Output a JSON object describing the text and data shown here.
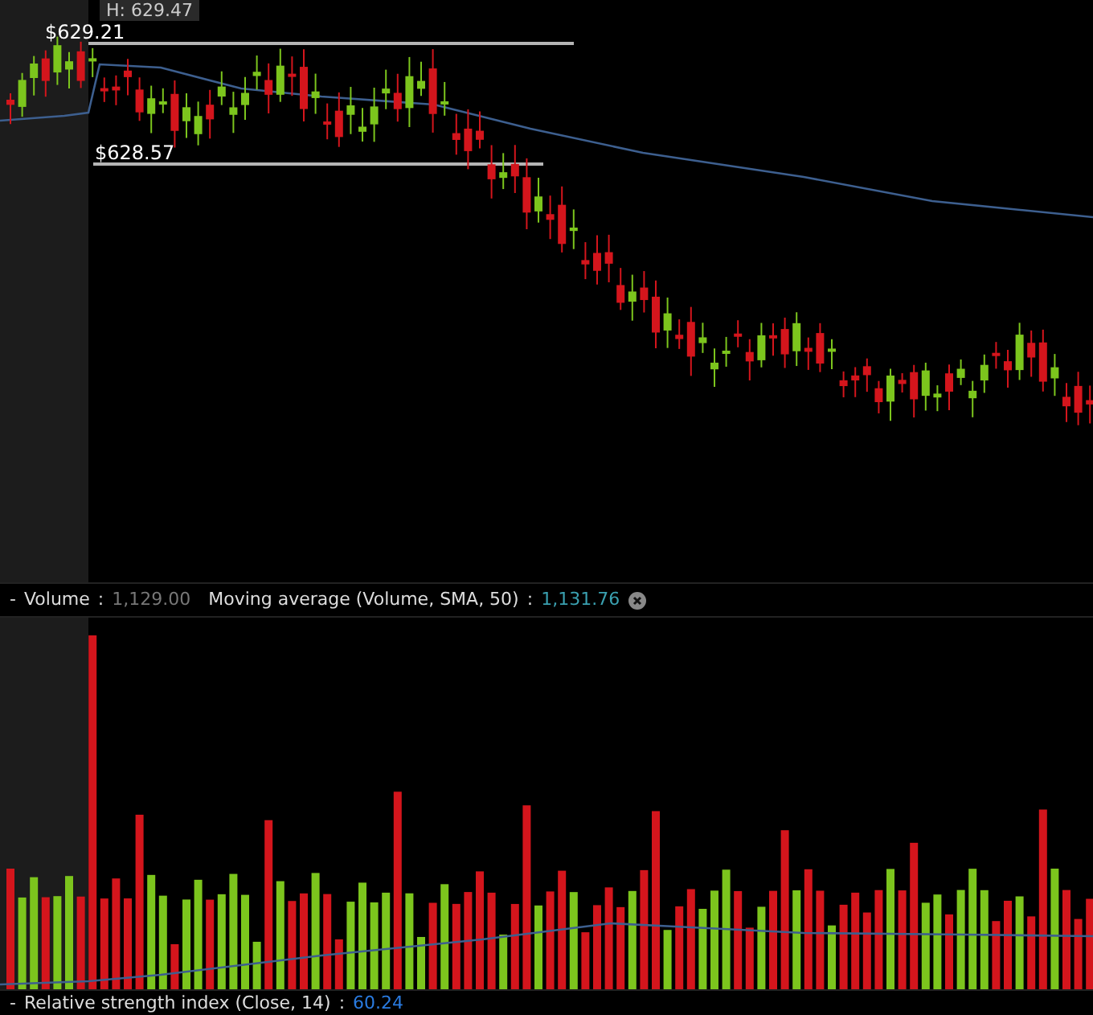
{
  "price_panel": {
    "high_label": "H: 629.47",
    "levels": [
      {
        "label": "$629.21"
      },
      {
        "label": "$628.57"
      }
    ]
  },
  "volume_panel": {
    "collapse": "-",
    "title": "Volume",
    "separator": ":",
    "value": "1,129.00",
    "study": "Moving average (Volume, SMA, 50)",
    "study_separator": ":",
    "study_value": "1,131.76"
  },
  "rsi_panel": {
    "collapse": "-",
    "title": "Relative strength index (Close, 14)",
    "separator": ":",
    "value": "60.24"
  }
}
